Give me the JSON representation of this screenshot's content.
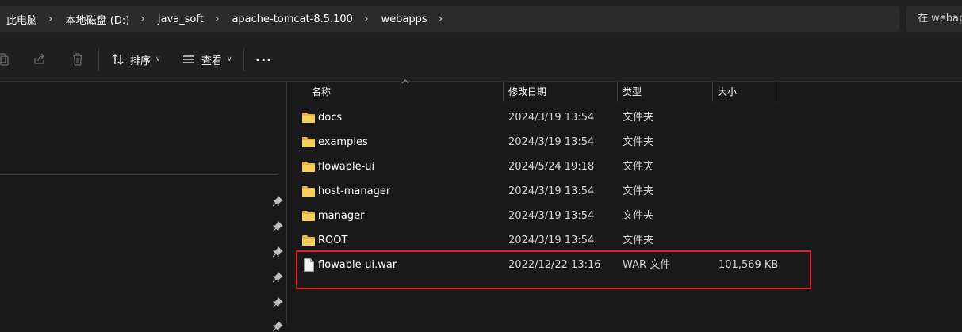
{
  "address": {
    "crumbs": [
      "此电脑",
      "本地磁盘 (D:)",
      "java_soft",
      "apache-tomcat-8.5.100",
      "webapps"
    ],
    "search_placeholder": "在 webapps 中搜索"
  },
  "toolbar": {
    "sort_label": "排序",
    "view_label": "查看",
    "more_label": "···"
  },
  "columns": {
    "name": "名称",
    "date": "修改日期",
    "type": "类型",
    "size": "大小"
  },
  "files": [
    {
      "name": "docs",
      "date": "2024/3/19 13:54",
      "type": "文件夹",
      "size": "",
      "icon": "folder-icon"
    },
    {
      "name": "examples",
      "date": "2024/3/19 13:54",
      "type": "文件夹",
      "size": "",
      "icon": "folder-icon"
    },
    {
      "name": "flowable-ui",
      "date": "2024/5/24 19:18",
      "type": "文件夹",
      "size": "",
      "icon": "folder-icon"
    },
    {
      "name": "host-manager",
      "date": "2024/3/19 13:54",
      "type": "文件夹",
      "size": "",
      "icon": "folder-icon"
    },
    {
      "name": "manager",
      "date": "2024/3/19 13:54",
      "type": "文件夹",
      "size": "",
      "icon": "folder-icon"
    },
    {
      "name": "ROOT",
      "date": "2024/3/19 13:54",
      "type": "文件夹",
      "size": "",
      "icon": "folder-icon"
    },
    {
      "name": "flowable-ui.war",
      "date": "2022/12/22 13:16",
      "type": "WAR 文件",
      "size": "101,569 KB",
      "icon": "file-icon"
    }
  ],
  "colors": {
    "highlight": "#e0202a",
    "folder": "#f4c552"
  }
}
